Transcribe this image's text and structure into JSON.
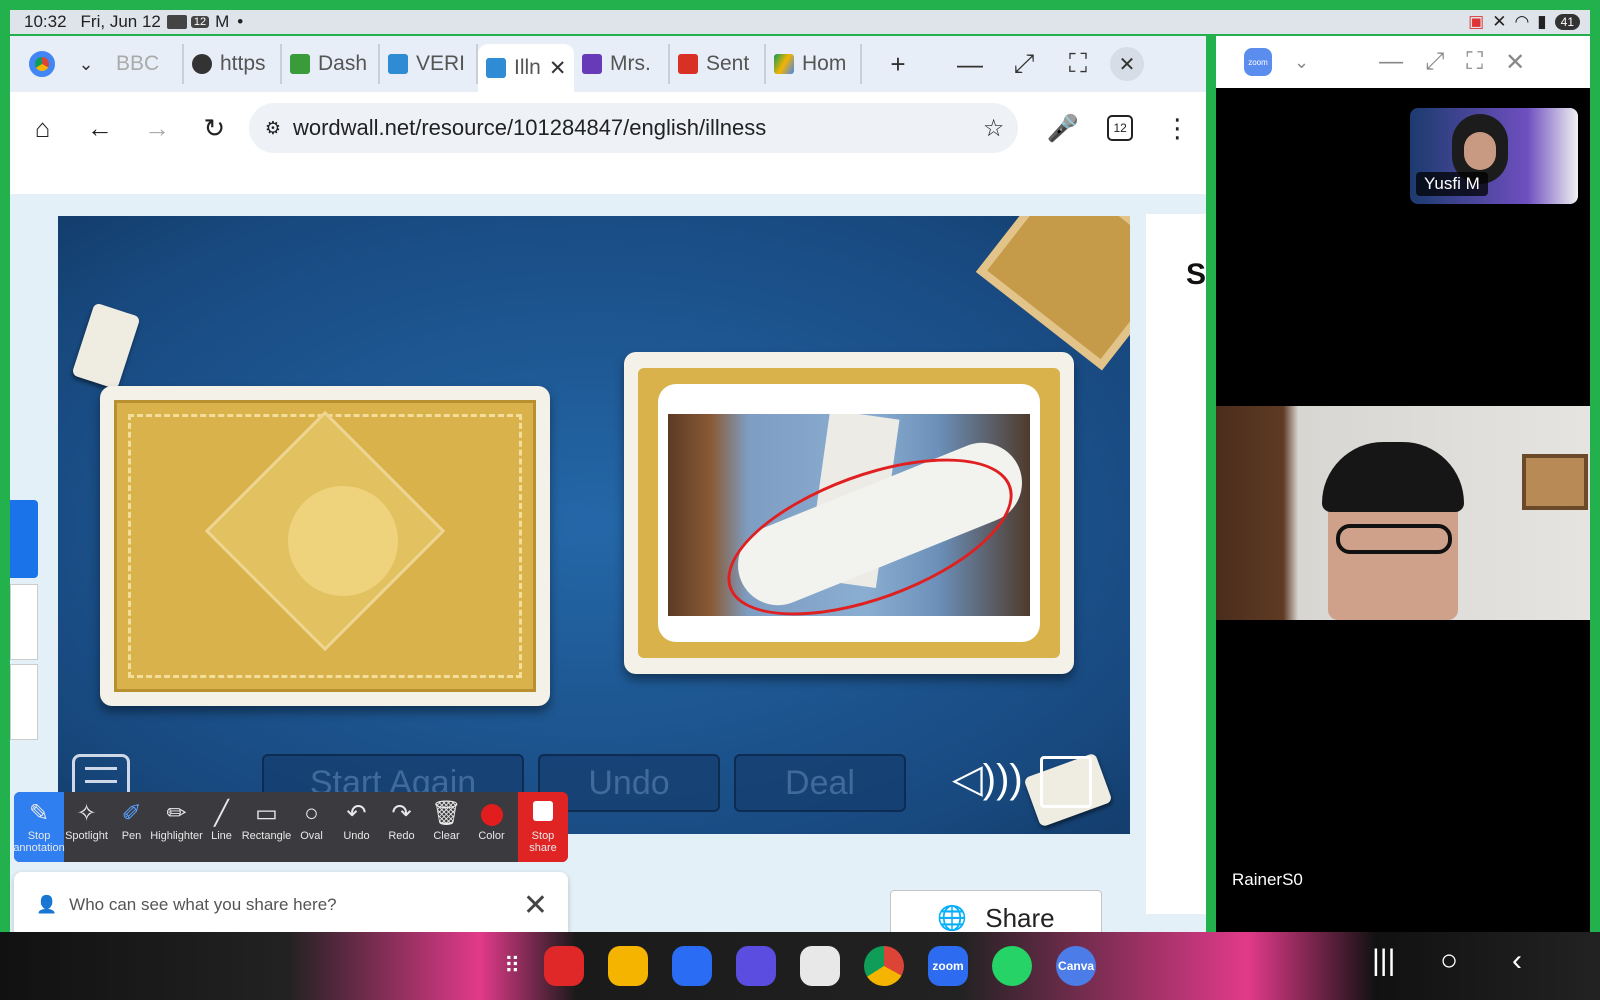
{
  "status_bar": {
    "time": "10:32",
    "date": "Fri, Jun 12",
    "notification_count": "12",
    "battery": "41"
  },
  "tabs": [
    {
      "label": "BBC",
      "icon": "bbc-icon",
      "color": "#b0b0b0"
    },
    {
      "label": "https",
      "icon": "globe-icon",
      "color": "#333333"
    },
    {
      "label": "Dash",
      "icon": "dash-icon",
      "color": "#3a9b3a"
    },
    {
      "label": "VERI",
      "icon": "wordwall-icon",
      "color": "#2e8bd4"
    },
    {
      "label": "Illn",
      "icon": "wordwall-icon",
      "color": "#2e8bd4",
      "active": true
    },
    {
      "label": "Mrs.",
      "icon": "forms-icon",
      "color": "#673ab7"
    },
    {
      "label": "Sent",
      "icon": "gmail-icon",
      "color": "#d93025"
    },
    {
      "label": "Hom",
      "icon": "drive-icon",
      "color": "#f4b400"
    }
  ],
  "omnibox": {
    "url": "wordwall.net/resource/101284847/english/illness",
    "tab_count": "12"
  },
  "game": {
    "buttons": [
      "Start Again",
      "Undo",
      "Deal"
    ]
  },
  "side_panel_letter": "S",
  "share_button": "Share",
  "annotation_tools": [
    {
      "label": "Stop annotation",
      "icon": "pencil-icon"
    },
    {
      "label": "Spotlight",
      "icon": "spotlight-icon"
    },
    {
      "label": "Pen",
      "icon": "pen-icon"
    },
    {
      "label": "Highlighter",
      "icon": "highlighter-icon"
    },
    {
      "label": "Line",
      "icon": "line-icon"
    },
    {
      "label": "Rectangle",
      "icon": "rectangle-icon"
    },
    {
      "label": "Oval",
      "icon": "oval-icon"
    },
    {
      "label": "Undo",
      "icon": "undo-icon"
    },
    {
      "label": "Redo",
      "icon": "redo-icon"
    },
    {
      "label": "Clear",
      "icon": "trash-icon"
    },
    {
      "label": "Color",
      "icon": "color-dot-icon"
    },
    {
      "label": "Stop share",
      "icon": "stop-icon"
    }
  ],
  "share_note": "Who can see what you share here?",
  "zoom": {
    "participant1": "Yusfi M",
    "participant2": "RainerS0"
  },
  "colors": {
    "frame_green": "#22b14c",
    "chrome_blue": "#1a73e8",
    "annotation_active": "#2f7ff0",
    "stop_red": "#e02424"
  }
}
